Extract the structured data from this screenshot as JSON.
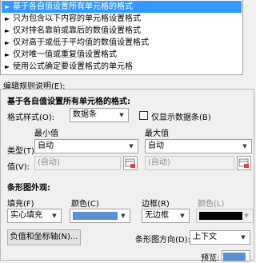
{
  "rule_types": [
    {
      "label": "基于各自值设置所有单元格的格式",
      "selected": true
    },
    {
      "label": "只为包含以下内容的单元格设置格式",
      "selected": false
    },
    {
      "label": "仅对排名靠前或靠后的数值设置格式",
      "selected": false
    },
    {
      "label": "仅对高于或低于平均值的数值设置格式",
      "selected": false
    },
    {
      "label": "仅对唯一值或重复值设置格式",
      "selected": false
    },
    {
      "label": "使用公式确定要设置格式的单元格",
      "selected": false
    }
  ],
  "edit": {
    "section_title": "编辑规则说明(E):",
    "heading": "基于各自值设置所有单元格的格式:",
    "format_style_label": "格式样式(O):",
    "format_style_value": "数据条",
    "show_bar_only_label": "仅显示数据条(B)",
    "min_label": "最小值",
    "max_label": "最大值",
    "type_label": "类型(T):",
    "min_type": "自动",
    "max_type": "自动",
    "value_label": "值(V):",
    "min_value": "(自动)",
    "max_value": "(自动)",
    "appearance_title": "条形图外观:",
    "fill_label": "填充(F)",
    "fill_color_label": "颜色(C)",
    "border_label": "边框(R)",
    "border_color_label": "颜色(L)",
    "fill_value": "实心填充",
    "border_value": "无边框",
    "negative_button": "负值和坐标轴(N)...",
    "direction_label": "条形图方向(D):",
    "direction_value": "上下文",
    "preview_label": "预览:"
  },
  "colors": {
    "selection": "#3399ff",
    "fill_color": "#5b8fd6",
    "border_color": "#000000"
  },
  "icons": {
    "list_marker": "triangle-right-icon",
    "dropdown": "chevron-down-icon",
    "cell_picker": "range-picker-icon"
  }
}
